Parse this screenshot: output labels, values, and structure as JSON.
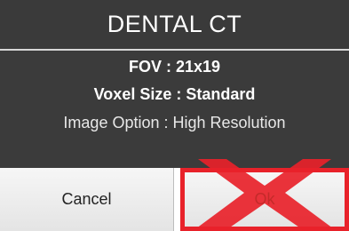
{
  "dialog": {
    "title": "DENTAL CT",
    "fov": "FOV : 21x19",
    "voxel_size": "Voxel Size : Standard",
    "image_option": "Image Option : High Resolution"
  },
  "buttons": {
    "cancel_label": "Cancel",
    "ok_label": "Ok"
  },
  "annotation": {
    "icon": "red-x-cross-icon",
    "color": "#e8222a"
  },
  "colors": {
    "title_bg": "#3a3a3a",
    "body_bg": "#3b3b3b",
    "highlight_red": "#e8222a"
  }
}
